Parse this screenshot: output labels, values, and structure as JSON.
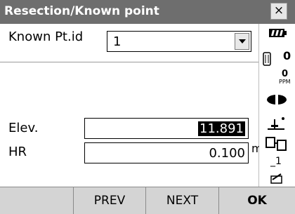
{
  "window": {
    "title": "Resection/Known point",
    "close_glyph": "×"
  },
  "form": {
    "known_pt_label": "Known Pt.id",
    "known_pt_value": "1",
    "elev_label": "Elev.",
    "elev_value": "11.891",
    "hr_label": "HR",
    "hr_value": "0.100",
    "hr_unit": "m"
  },
  "status": {
    "prism_constant": "0",
    "ppm_value": "0",
    "ppm_unit": "PPM",
    "input_mode": "_1",
    "icons": [
      "battery-icon",
      "prism-icon",
      "target-icon",
      "tilt-icon",
      "communication-icon",
      "input-mode-icon",
      "keyboard-pen-icon"
    ]
  },
  "softkeys": [
    "",
    "PREV",
    "NEXT",
    "OK"
  ],
  "colors": {
    "title_bar": "#6e6e6e",
    "softkey_bar": "#cfcfcf",
    "selection": "#000000"
  }
}
